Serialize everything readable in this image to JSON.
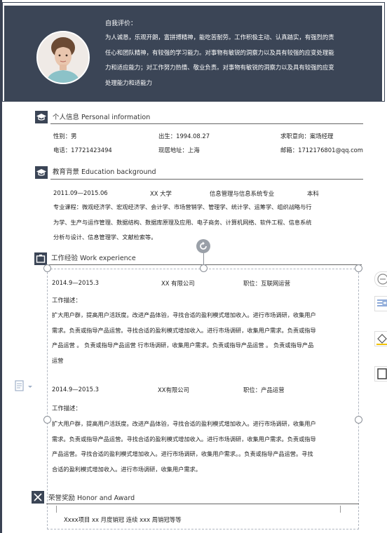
{
  "header": {
    "eval_title": "自我评价：",
    "eval_lines": [
      "为人诚恳，乐观开朗，富拼搏精神，能吃苦耐劳。工作积极主动、认真踏实，有强烈的责",
      "任心和团队精神，有较强的学习能力。对事物有敏锐的洞察力以及具有较强的应变处理能",
      "力和适应能力；对工作努力热情、敬业负责。对事物有敏锐的洞察力以及具有较强的应变",
      "处理能力和适能力"
    ]
  },
  "personal": {
    "title": "个人信息  Personal information",
    "gender": "性别：男",
    "birth": "出生：1994.08.27",
    "intent": "求职意向：案场经理",
    "phone": "电话：17721423494",
    "address": "现居地址：上海",
    "email": "邮箱：1712176801@qq.com"
  },
  "education": {
    "title": "教育背景  Education background",
    "period": "2011.09—2015.06",
    "school": "XX 大学",
    "major": "信息管理与信息系统专业",
    "degree": "本科",
    "course_lines": [
      "专业课程：微观经济学、宏观经济学、会计学、市场营销学、管理学、统计学、运筹学、组织战略与行",
      "为学、生产与运作管理、数据结构、数据库原理及应用、电子商务、计算机网络、软件工程、信息系统",
      "分析与设计、信息管理学、文献检索等。"
    ]
  },
  "work": {
    "title": "工作经验  Work experience",
    "jobs": [
      {
        "period": "2014.9—2015.3",
        "company": "XX 有限公司",
        "position": "职位：互联网运营",
        "desc_label": "工作描述：",
        "desc_lines": [
          "扩大用户群，提高用户活跃度。改进产品体验，寻找合适的盈利模式增加收入。进行市场调研，收集用户",
          "需求。负责或指导产品运营。寻找合适的盈利模式增加收入。进行市场调研，收集用户需求。负责或指导",
          "产品运营 。 负责或指导产品运营 行市场调研，收集用户需求。负责或指导产品运营 。 负责或指导产品",
          "运营"
        ]
      },
      {
        "period": "2014.9—2015.3",
        "company": "XX有限公司",
        "position": "职位：产品运营",
        "desc_label": "工作描述：",
        "desc_lines": [
          "扩大用户群，提高用户活跃度。改进产品体验，寻找合适的盈利模式增加收入。进行市场调研，收集用户",
          "需求。负责或指导产品运营。寻找合适的盈利模式增加收入。进行市场调研，收集用户需求。负责或指导",
          "产品运营。寻找合适的盈利模式增加收入。进行市场调研，收集用户需求。。负责或指导产品运营。寻找",
          "合适的盈利模式增加收入。进行市场调研，收集用户需求。"
        ]
      }
    ]
  },
  "honor": {
    "title": "荣誉奖励  Honor and Award",
    "line": "Xxxx项目 xx 月度销冠      连续 xxx 周销冠等等"
  },
  "colors": {
    "header_bg": "#3b4556",
    "accent": "#3b4556"
  }
}
